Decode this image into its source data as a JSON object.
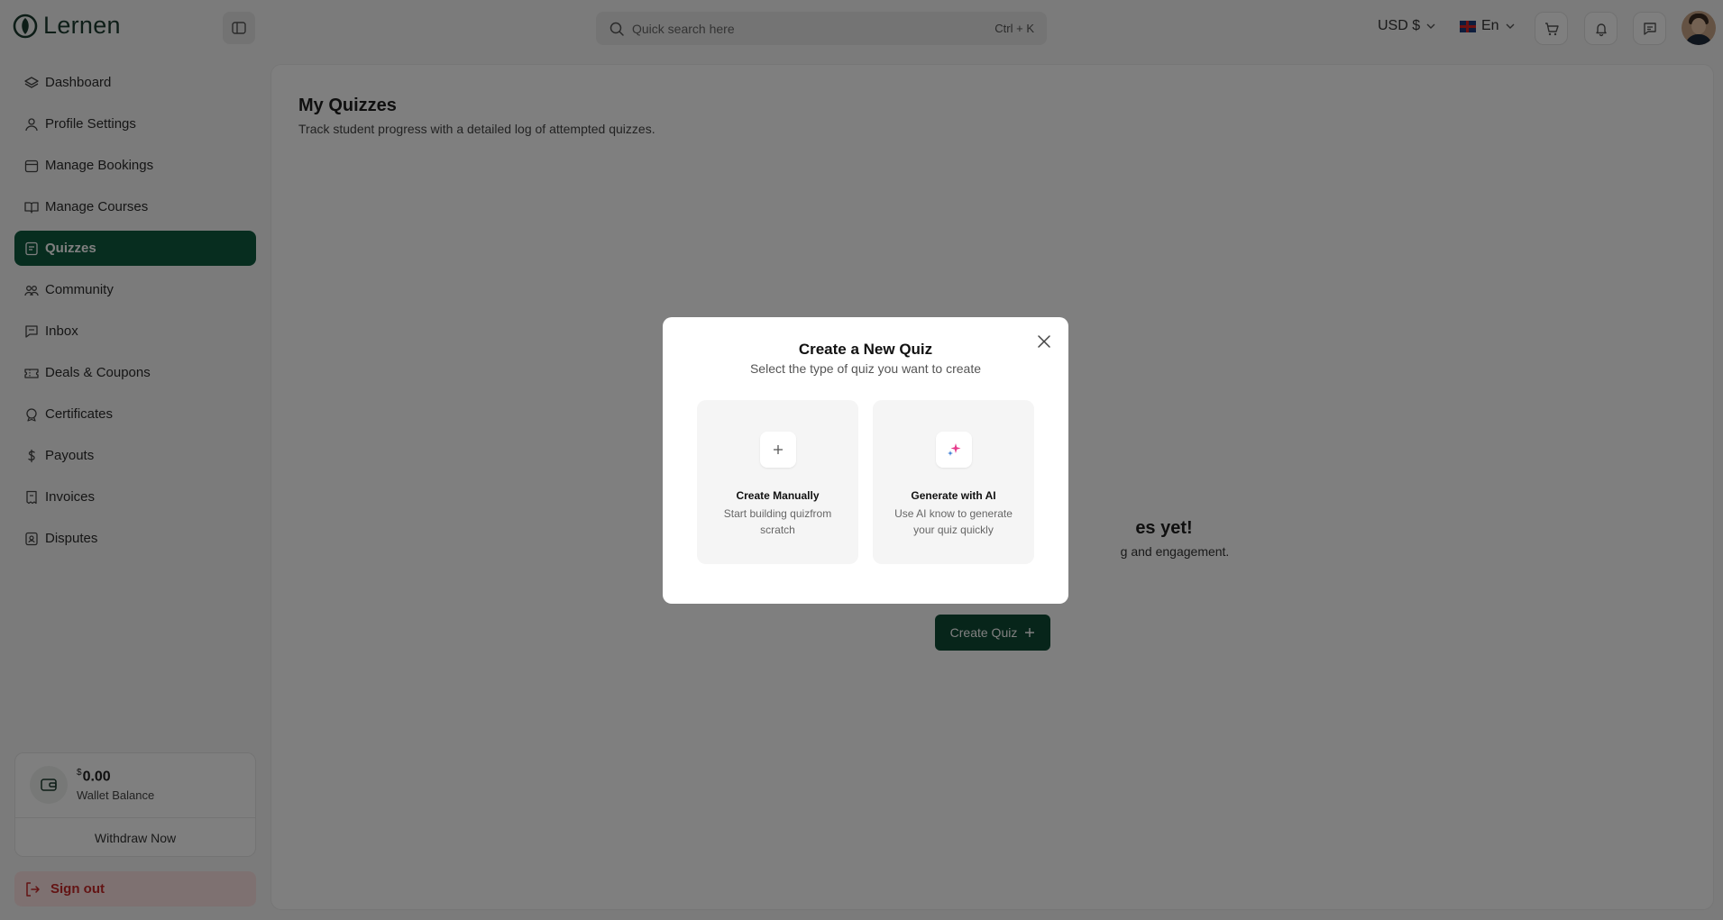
{
  "app": {
    "name": "Lernen"
  },
  "search": {
    "placeholder": "Quick search here",
    "shortcut": "Ctrl + K"
  },
  "header": {
    "currency": "USD $",
    "language": "En"
  },
  "sidebar": {
    "items": [
      {
        "label": "Dashboard",
        "icon": "layers-icon"
      },
      {
        "label": "Profile Settings",
        "icon": "user-icon"
      },
      {
        "label": "Manage Bookings",
        "icon": "calendar-icon"
      },
      {
        "label": "Manage Courses",
        "icon": "book-icon"
      },
      {
        "label": "Quizzes",
        "icon": "quiz-icon",
        "active": true
      },
      {
        "label": "Community",
        "icon": "community-icon"
      },
      {
        "label": "Inbox",
        "icon": "chat-icon"
      },
      {
        "label": "Deals & Coupons",
        "icon": "ticket-icon"
      },
      {
        "label": "Certificates",
        "icon": "certificate-icon"
      },
      {
        "label": "Payouts",
        "icon": "dollar-icon"
      },
      {
        "label": "Invoices",
        "icon": "invoice-icon"
      },
      {
        "label": "Disputes",
        "icon": "dispute-icon"
      }
    ],
    "wallet": {
      "currency_symbol": "$",
      "amount": "0.00",
      "label": "Wallet Balance",
      "withdraw_label": "Withdraw Now"
    },
    "signout_label": "Sign out"
  },
  "main": {
    "title": "My Quizzes",
    "subtitle": "Track student progress with a detailed log of attempted quizzes.",
    "empty_title": "es yet!",
    "empty_subtitle": "g and engagement.",
    "create_button": "Create Quiz"
  },
  "modal": {
    "title": "Create a New Quiz",
    "subtitle": "Select the type of quiz you want to create",
    "options": [
      {
        "title": "Create Manually",
        "desc": "Start building quizfrom scratch",
        "icon": "plus-icon"
      },
      {
        "title": "Generate with AI",
        "desc": "Use AI know to generate your quiz quickly",
        "icon": "sparkle-icon"
      }
    ]
  },
  "colors": {
    "accent": "#0f5a3f",
    "button": "#0f4a34",
    "signout": "#c62828",
    "signout_bg": "#fde3e3"
  }
}
